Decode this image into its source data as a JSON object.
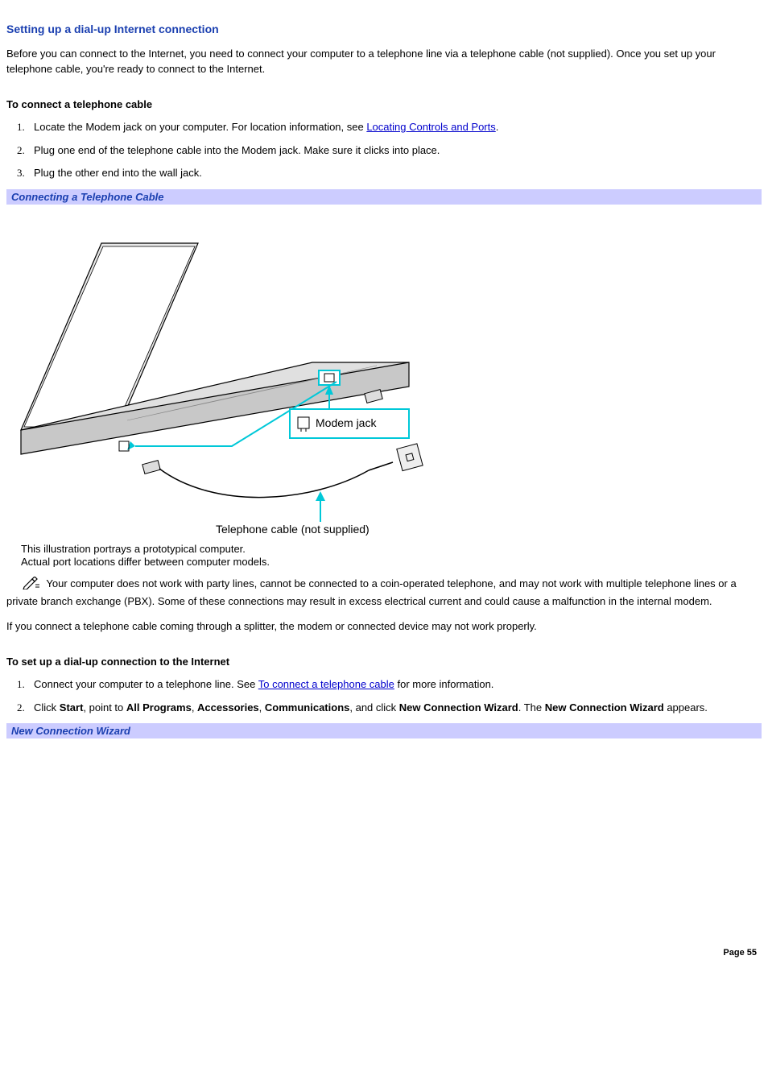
{
  "heading": "Setting up a dial-up Internet connection",
  "intro": "Before you can connect to the Internet, you need to connect your computer to a telephone line via a telephone cable (not supplied). Once you set up your telephone cable, you're ready to connect to the Internet.",
  "section1": {
    "title": "To connect a telephone cable",
    "steps": {
      "s1_pre": "Locate the Modem jack on your computer. For location information, see ",
      "s1_link": "Locating Controls and Ports",
      "s1_post": ".",
      "s2": "Plug one end of the telephone cable into the Modem jack. Make sure it clicks into place.",
      "s3": "Plug the other end into the wall jack."
    }
  },
  "figure1": {
    "caption": "Connecting a Telephone Cable",
    "label_modem": "Modem jack",
    "label_cable": "Telephone cable (not supplied)",
    "desc1": "This illustration portrays a prototypical computer.",
    "desc2": "Actual port locations differ between computer models."
  },
  "note1": "Your computer does not work with party lines, cannot be connected to a coin-operated telephone, and may not work with multiple telephone lines or a private branch exchange (PBX). Some of these connections may result in excess electrical current and could cause a malfunction in the internal modem.",
  "splitter_note": "If you connect a telephone cable coming through a splitter, the modem or connected device may not work properly.",
  "section2": {
    "title": "To set up a dial-up connection to the Internet",
    "steps": {
      "s1_pre": "Connect your computer to a telephone line. See ",
      "s1_link": "To connect a telephone cable",
      "s1_post": " for more information.",
      "s2_p1": "Click ",
      "s2_b1": "Start",
      "s2_p2": ", point to ",
      "s2_b2": "All Programs",
      "s2_p3": ", ",
      "s2_b3": "Accessories",
      "s2_p4": ", ",
      "s2_b4": "Communications",
      "s2_p5": ", and click ",
      "s2_b5": "New Connection Wizard",
      "s2_p6": ". The ",
      "s2_b6": "New Connection Wizard",
      "s2_p7": " appears."
    }
  },
  "figure2": {
    "caption": "New Connection Wizard"
  },
  "footer": "Page 55"
}
